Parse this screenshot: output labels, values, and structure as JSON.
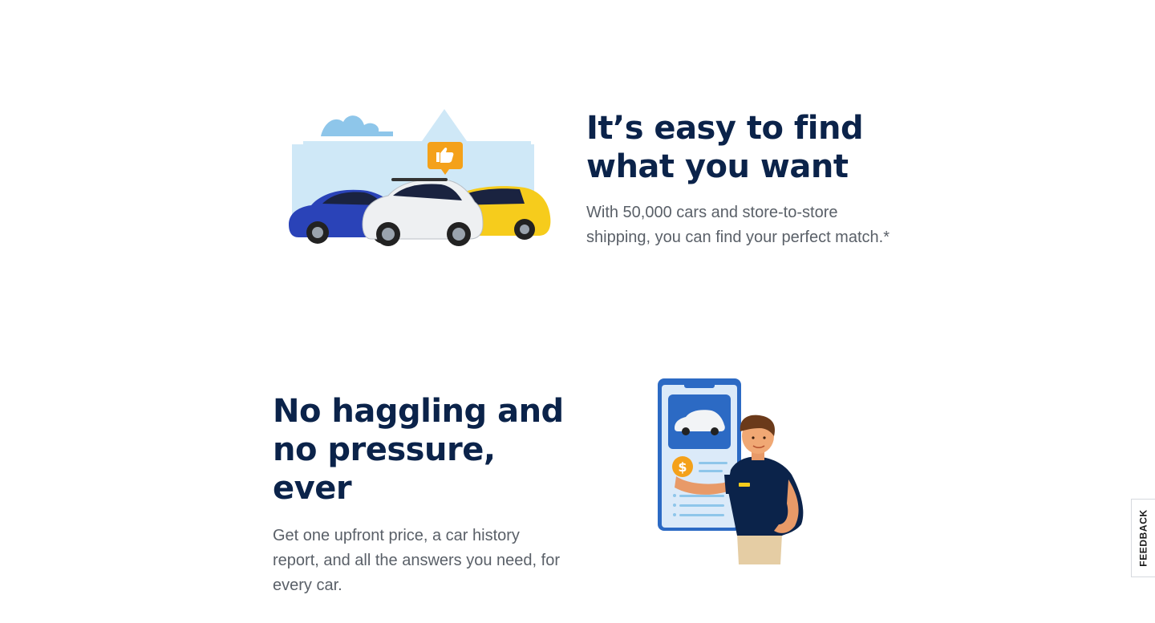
{
  "sections": {
    "find": {
      "heading_line1": "It’s easy to find",
      "heading_line2": "what you want",
      "body": "With 50,000 cars and store-to-store shipping, you can find your perfect match.*",
      "illustration_icon": "thumbs-up-icon"
    },
    "haggle": {
      "heading_line1": "No haggling and",
      "heading_line2": "no pressure, ever",
      "body": "Get one upfront price, a car history report, and all the answers you need, for every car.",
      "illustration_icon": "dollar-icon"
    }
  },
  "feedback": {
    "label": "FEEDBACK"
  },
  "colors": {
    "heading": "#0b234a",
    "body": "#5a6068",
    "accent_orange": "#f4a11a",
    "sky_blue": "#cfe8f7",
    "phone_blue": "#2c6ac4"
  }
}
